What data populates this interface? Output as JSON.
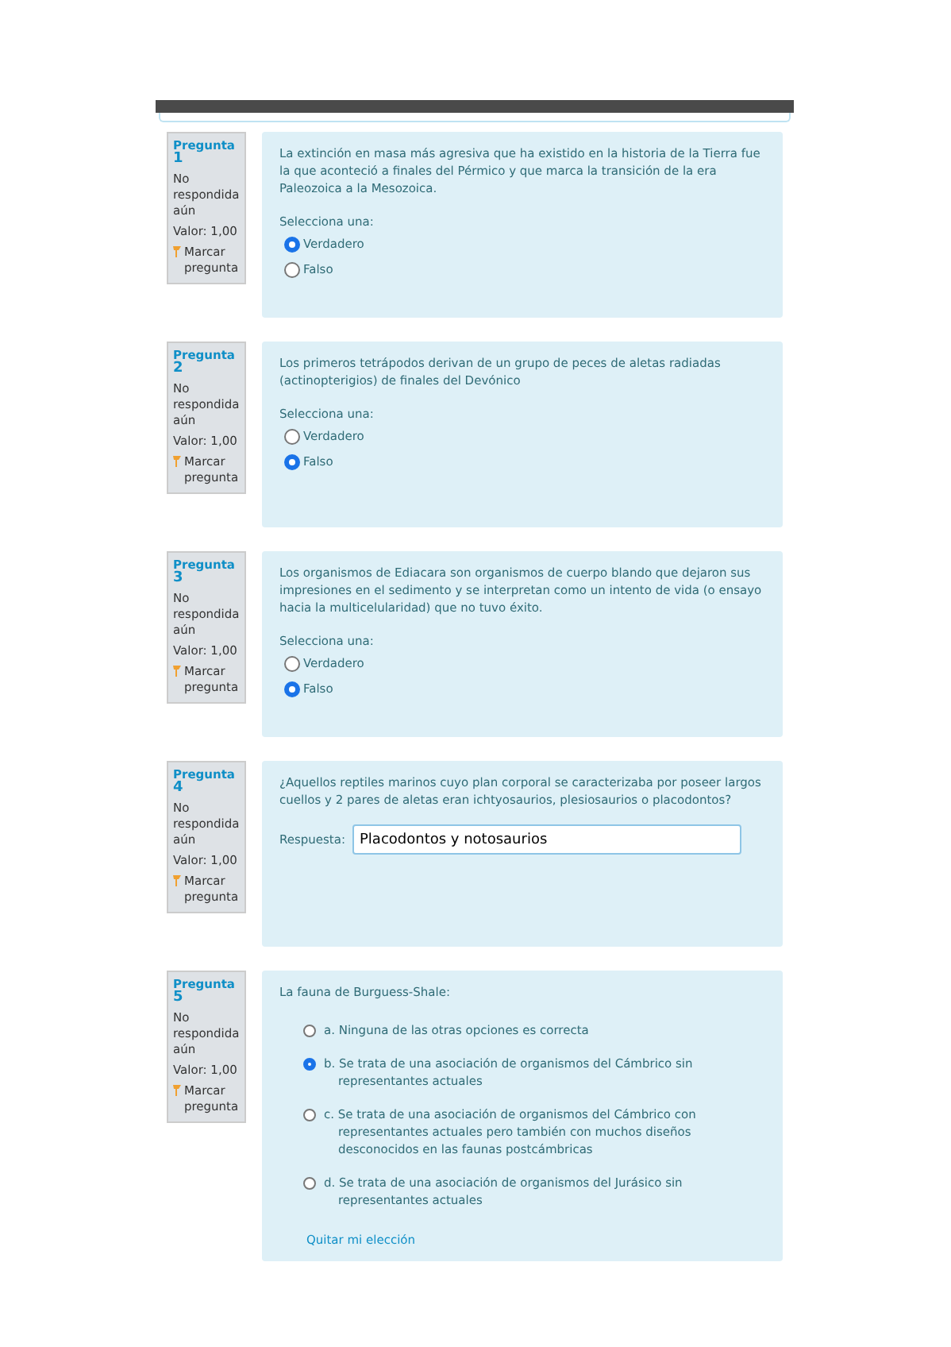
{
  "questions": [
    {
      "kind": "choice",
      "label": "Pregunta",
      "number": "1",
      "status": "No respondida aún",
      "value": "Valor: 1,00",
      "flag": "Marcar pregunta",
      "text": "La extinción en masa más agresiva que ha existido en la historia de la Tierra fue la que aconteció a finales del Pérmico y que marca la transición de la era Paleozoica a la Mesozoica.",
      "prompt": "Selecciona una:",
      "options": [
        {
          "label": "Verdadero",
          "selected": true
        },
        {
          "label": "Falso",
          "selected": false
        }
      ]
    },
    {
      "kind": "choice",
      "label": "Pregunta",
      "number": "2",
      "status": "No respondida aún",
      "value": "Valor: 1,00",
      "flag": "Marcar pregunta",
      "text": "Los primeros tetrápodos derivan de un grupo de peces de aletas radiadas (actinopterigios) de finales del Devónico",
      "prompt": "Selecciona una:",
      "options": [
        {
          "label": "Verdadero",
          "selected": false
        },
        {
          "label": "Falso",
          "selected": true
        }
      ]
    },
    {
      "kind": "choice",
      "label": "Pregunta",
      "number": "3",
      "status": "No respondida aún",
      "value": "Valor: 1,00",
      "flag": "Marcar pregunta",
      "text": "Los organismos de Ediacara son organismos de cuerpo blando que dejaron sus impresiones en el sedimento y se interpretan como un intento de vida (o ensayo hacia la multicelularidad) que no tuvo éxito.",
      "prompt": "Selecciona una:",
      "options": [
        {
          "label": "Verdadero",
          "selected": false
        },
        {
          "label": "Falso",
          "selected": true
        }
      ]
    },
    {
      "kind": "short",
      "label": "Pregunta",
      "number": "4",
      "status": "No respondida aún",
      "value": "Valor: 1,00",
      "flag": "Marcar pregunta",
      "text": "¿Aquellos reptiles marinos cuyo plan corporal se caracterizaba por poseer largos cuellos y 2 pares de aletas eran ichtyosaurios, plesiosaurios o placodontos?",
      "answer_label": "Respuesta:",
      "answer": "Placodontos y notosaurios"
    },
    {
      "kind": "multi",
      "label": "Pregunta",
      "number": "5",
      "status": "No respondida aún",
      "value": "Valor: 1,00",
      "flag": "Marcar pregunta",
      "text": "La fauna de Burguess-Shale:",
      "options": [
        {
          "label": "a. Ninguna de las otras opciones es correcta",
          "selected": false
        },
        {
          "label": "b. Se trata de una asociación de organismos del Cámbrico sin representantes actuales",
          "selected": true
        },
        {
          "label": "c. Se trata de una asociación de organismos del Cámbrico con representantes actuales pero también con muchos diseños desconocidos en las faunas postcámbricas",
          "selected": false
        },
        {
          "label": "d. Se trata de una asociación de organismos del Jurásico sin representantes actuales",
          "selected": false
        }
      ],
      "clear_link": "Quitar mi elección"
    }
  ]
}
